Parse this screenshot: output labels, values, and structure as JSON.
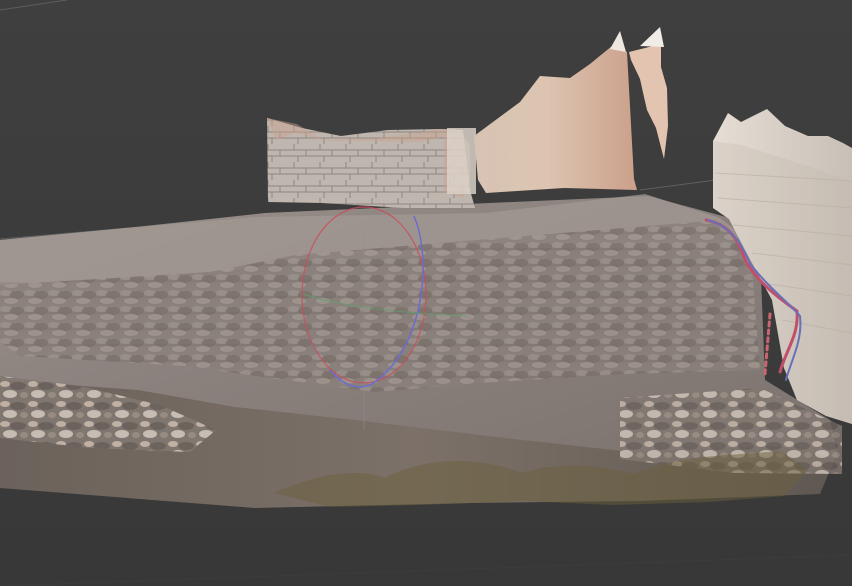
{
  "viewport": {
    "title": "",
    "background_color": "#3b3b3b",
    "grid_line_color": "#6a6a6a",
    "model_palette": {
      "terrace_stone": "#8d8683",
      "terrace_highlight": "#c9b7ad",
      "wall_warm": "#c6a390",
      "wall_light": "#e8ddd5",
      "concrete": "#d3ccc3",
      "foreground_dark": "#5f564f",
      "vegetation": "#6b5f3b",
      "pipe_red": "#c0506a",
      "pipe_blue": "#6770b8",
      "gizmo_red": "#c84f5c",
      "gizmo_blue": "#6d6bd0",
      "gizmo_green": "#58a56a"
    },
    "icons": {
      "rotation_gizmo": "rotation-gizmo-icon"
    }
  }
}
